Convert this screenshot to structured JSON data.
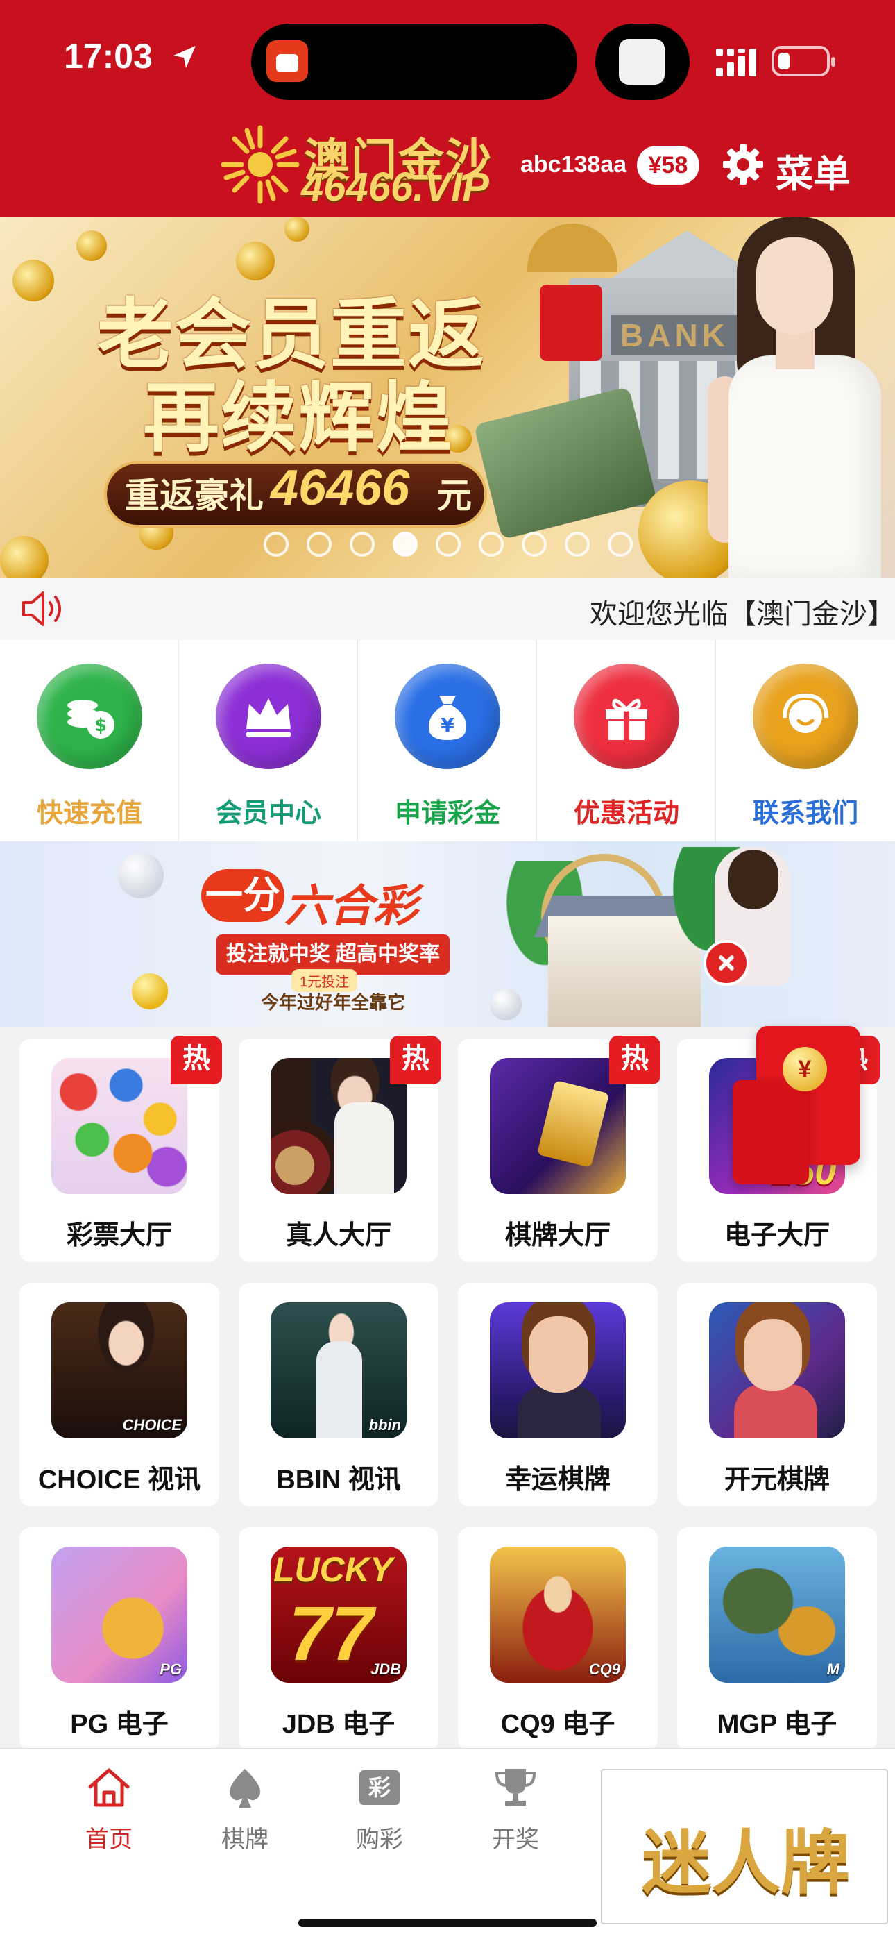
{
  "status_bar": {
    "time": "17:03"
  },
  "header": {
    "logo_cn": "澳门金沙",
    "logo_domain": "46466.VIP",
    "username": "abc138aa",
    "balance": "¥58",
    "menu_label": "菜单"
  },
  "banner": {
    "line1": "老会员重返",
    "line2": "再续辉煌",
    "pill_prefix": "重返豪礼",
    "pill_amount": "46466",
    "pill_unit": "元",
    "bank_text": "BANK",
    "dot_count": 9,
    "active_dot": 3
  },
  "marquee": {
    "text": "欢迎您光临【澳门金沙】"
  },
  "quick_menu": [
    {
      "label": "快速充值",
      "color": "#e8a63a",
      "circle": "#2eb34a",
      "icon": "coins-icon"
    },
    {
      "label": "会员中心",
      "color": "#139a76",
      "circle": "#8c2fd6",
      "icon": "crown-icon"
    },
    {
      "label": "申请彩金",
      "color": "#18a34a",
      "circle": "#2a6fe6",
      "icon": "money-bag-icon"
    },
    {
      "label": "优惠活动",
      "color": "#e02424",
      "circle": "#ee2f3f",
      "icon": "gift-icon"
    },
    {
      "label": "联系我们",
      "color": "#2a6fd8",
      "circle": "#e8a21e",
      "icon": "headset-icon"
    }
  ],
  "ad_strip": {
    "badge": "一分",
    "title": "六合彩",
    "ribbon": "投注就中奖 超高中奖率",
    "sub1": "1元投注",
    "sub2": "今年过好年全靠它"
  },
  "games": [
    {
      "label": "彩票大厅",
      "hot": "热",
      "thumb": "lottery"
    },
    {
      "label": "真人大厅",
      "hot": "热",
      "thumb": "live"
    },
    {
      "label": "棋牌大厅",
      "hot": "热",
      "thumb": "chess"
    },
    {
      "label": "电子大厅",
      "hot": "热",
      "thumb": "slot"
    },
    {
      "label": "CHOICE 视讯",
      "hot": "",
      "thumb": "choice",
      "brand": "CHOICE"
    },
    {
      "label": "BBIN 视讯",
      "hot": "",
      "thumb": "bbin",
      "brand": "bbin"
    },
    {
      "label": "幸运棋牌",
      "hot": "",
      "thumb": "lucky"
    },
    {
      "label": "开元棋牌",
      "hot": "",
      "thumb": "kaiyuan"
    },
    {
      "label": "PG 电子",
      "hot": "",
      "thumb": "pg",
      "brand": "PG"
    },
    {
      "label": "JDB 电子",
      "hot": "",
      "thumb": "jdb",
      "brand": "JDB",
      "art_top": "LUCKY",
      "art_num": "77"
    },
    {
      "label": "CQ9 电子",
      "hot": "",
      "thumb": "cq9",
      "brand": "CQ9"
    },
    {
      "label": "MGP 电子",
      "hot": "",
      "thumb": "mgp",
      "brand": "M"
    }
  ],
  "envelope": {
    "coin": "¥"
  },
  "tabbar": {
    "tabs": [
      {
        "label": "首页",
        "icon": "home-icon",
        "active": true
      },
      {
        "label": "棋牌",
        "icon": "spade-icon",
        "active": false
      },
      {
        "label": "购彩",
        "icon": "lottery-ticket-icon",
        "active": false,
        "glyph": "彩"
      },
      {
        "label": "开奖",
        "icon": "trophy-icon",
        "active": false
      }
    ],
    "ad_text": "迷人牌"
  },
  "colors": {
    "brand_red": "#c8101e",
    "hot_red": "#e41d23",
    "gold": "#f7d56b"
  }
}
